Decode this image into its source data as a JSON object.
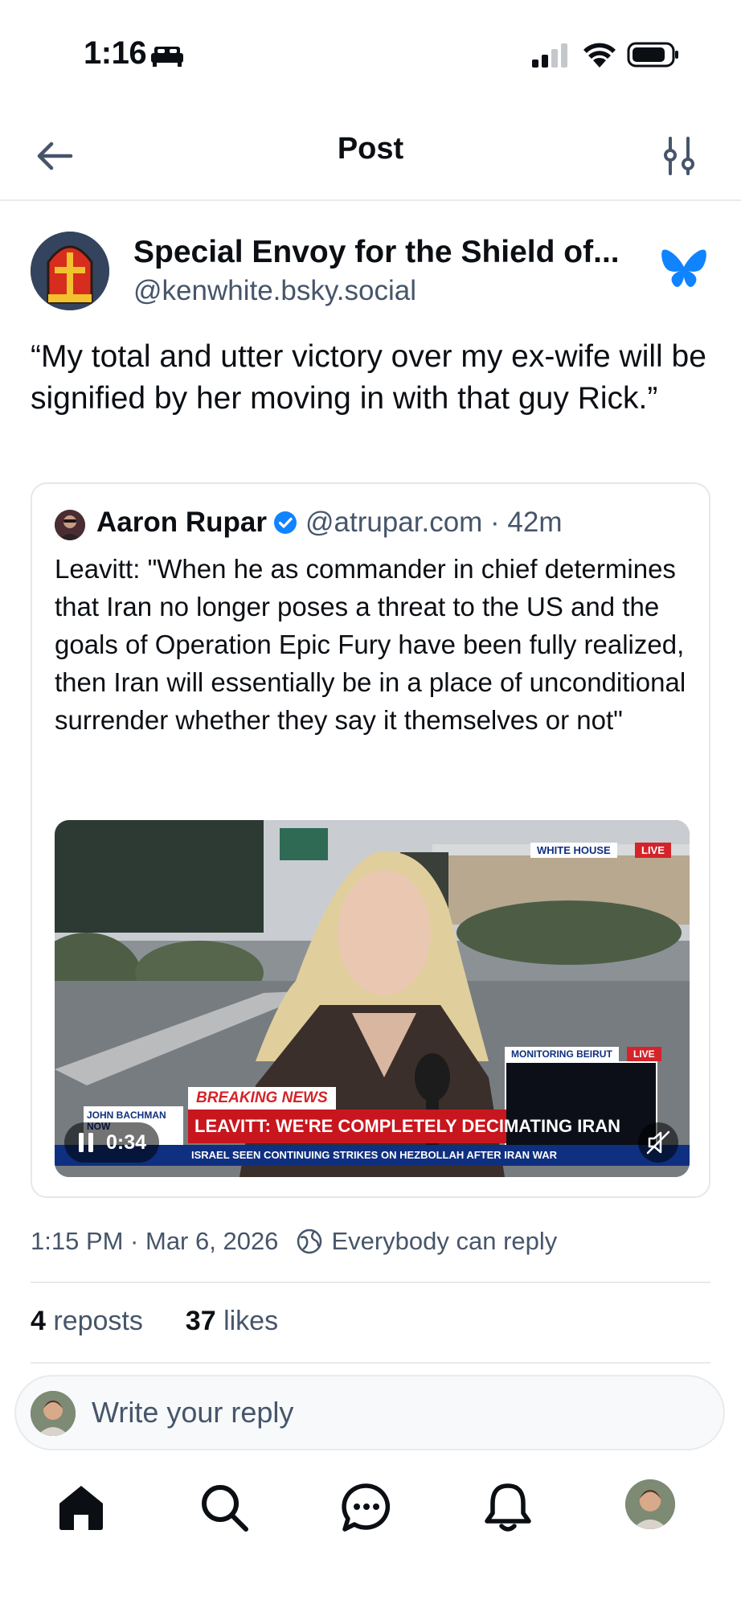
{
  "status_bar": {
    "time": "1:16"
  },
  "header": {
    "title": "Post"
  },
  "post": {
    "author_name": "Special Envoy for the Shield of...",
    "author_handle": "@kenwhite.bsky.social",
    "text": "“My total and utter victory over my ex-wife will be signified by her moving in with that guy Rick.”"
  },
  "quote": {
    "author_name": "Aaron Rupar",
    "handle_time": "@atrupar.com · 42m",
    "text": "Leavitt: \"When he as commander in chief determines that Iran no longer poses a threat to the US and the goals of Operation Epic Fury have been fully realized, then Iran will essentially be in a place of unconditional surrender whether they say it themselves or not\"",
    "video": {
      "label_white_house": "WHITE HOUSE",
      "label_live": "LIVE",
      "label_monitoring": "MONITORING BEIRUT",
      "breaking": "BREAKING NEWS",
      "headline": "LEAVITT: WE'RE COMPLETELY DECIMATING IRAN",
      "ticker": "ISRAEL SEEN CONTINUING STRIKES ON HEZBOLLAH AFTER IRAN WAR",
      "lower_third": "JOHN BACHMAN NOW",
      "duration": "0:34"
    }
  },
  "meta": {
    "timestamp": "1:15 PM · Mar 6, 2026",
    "reply_setting": "Everybody can reply"
  },
  "stats": {
    "reposts_count": "4",
    "reposts_label": "reposts",
    "likes_count": "37",
    "likes_label": "likes"
  },
  "reply": {
    "placeholder": "Write your reply"
  },
  "colors": {
    "accent": "#1083fe",
    "text": "#0b0f14",
    "muted": "#46556a",
    "border": "#e8ebee"
  },
  "icons": [
    "back-arrow-icon",
    "filter-sliders-icon",
    "bluesky-butterfly-icon",
    "verified-badge-icon",
    "globe-icon",
    "pause-icon",
    "mute-icon",
    "home-icon",
    "search-icon",
    "chat-icon",
    "bell-icon"
  ]
}
